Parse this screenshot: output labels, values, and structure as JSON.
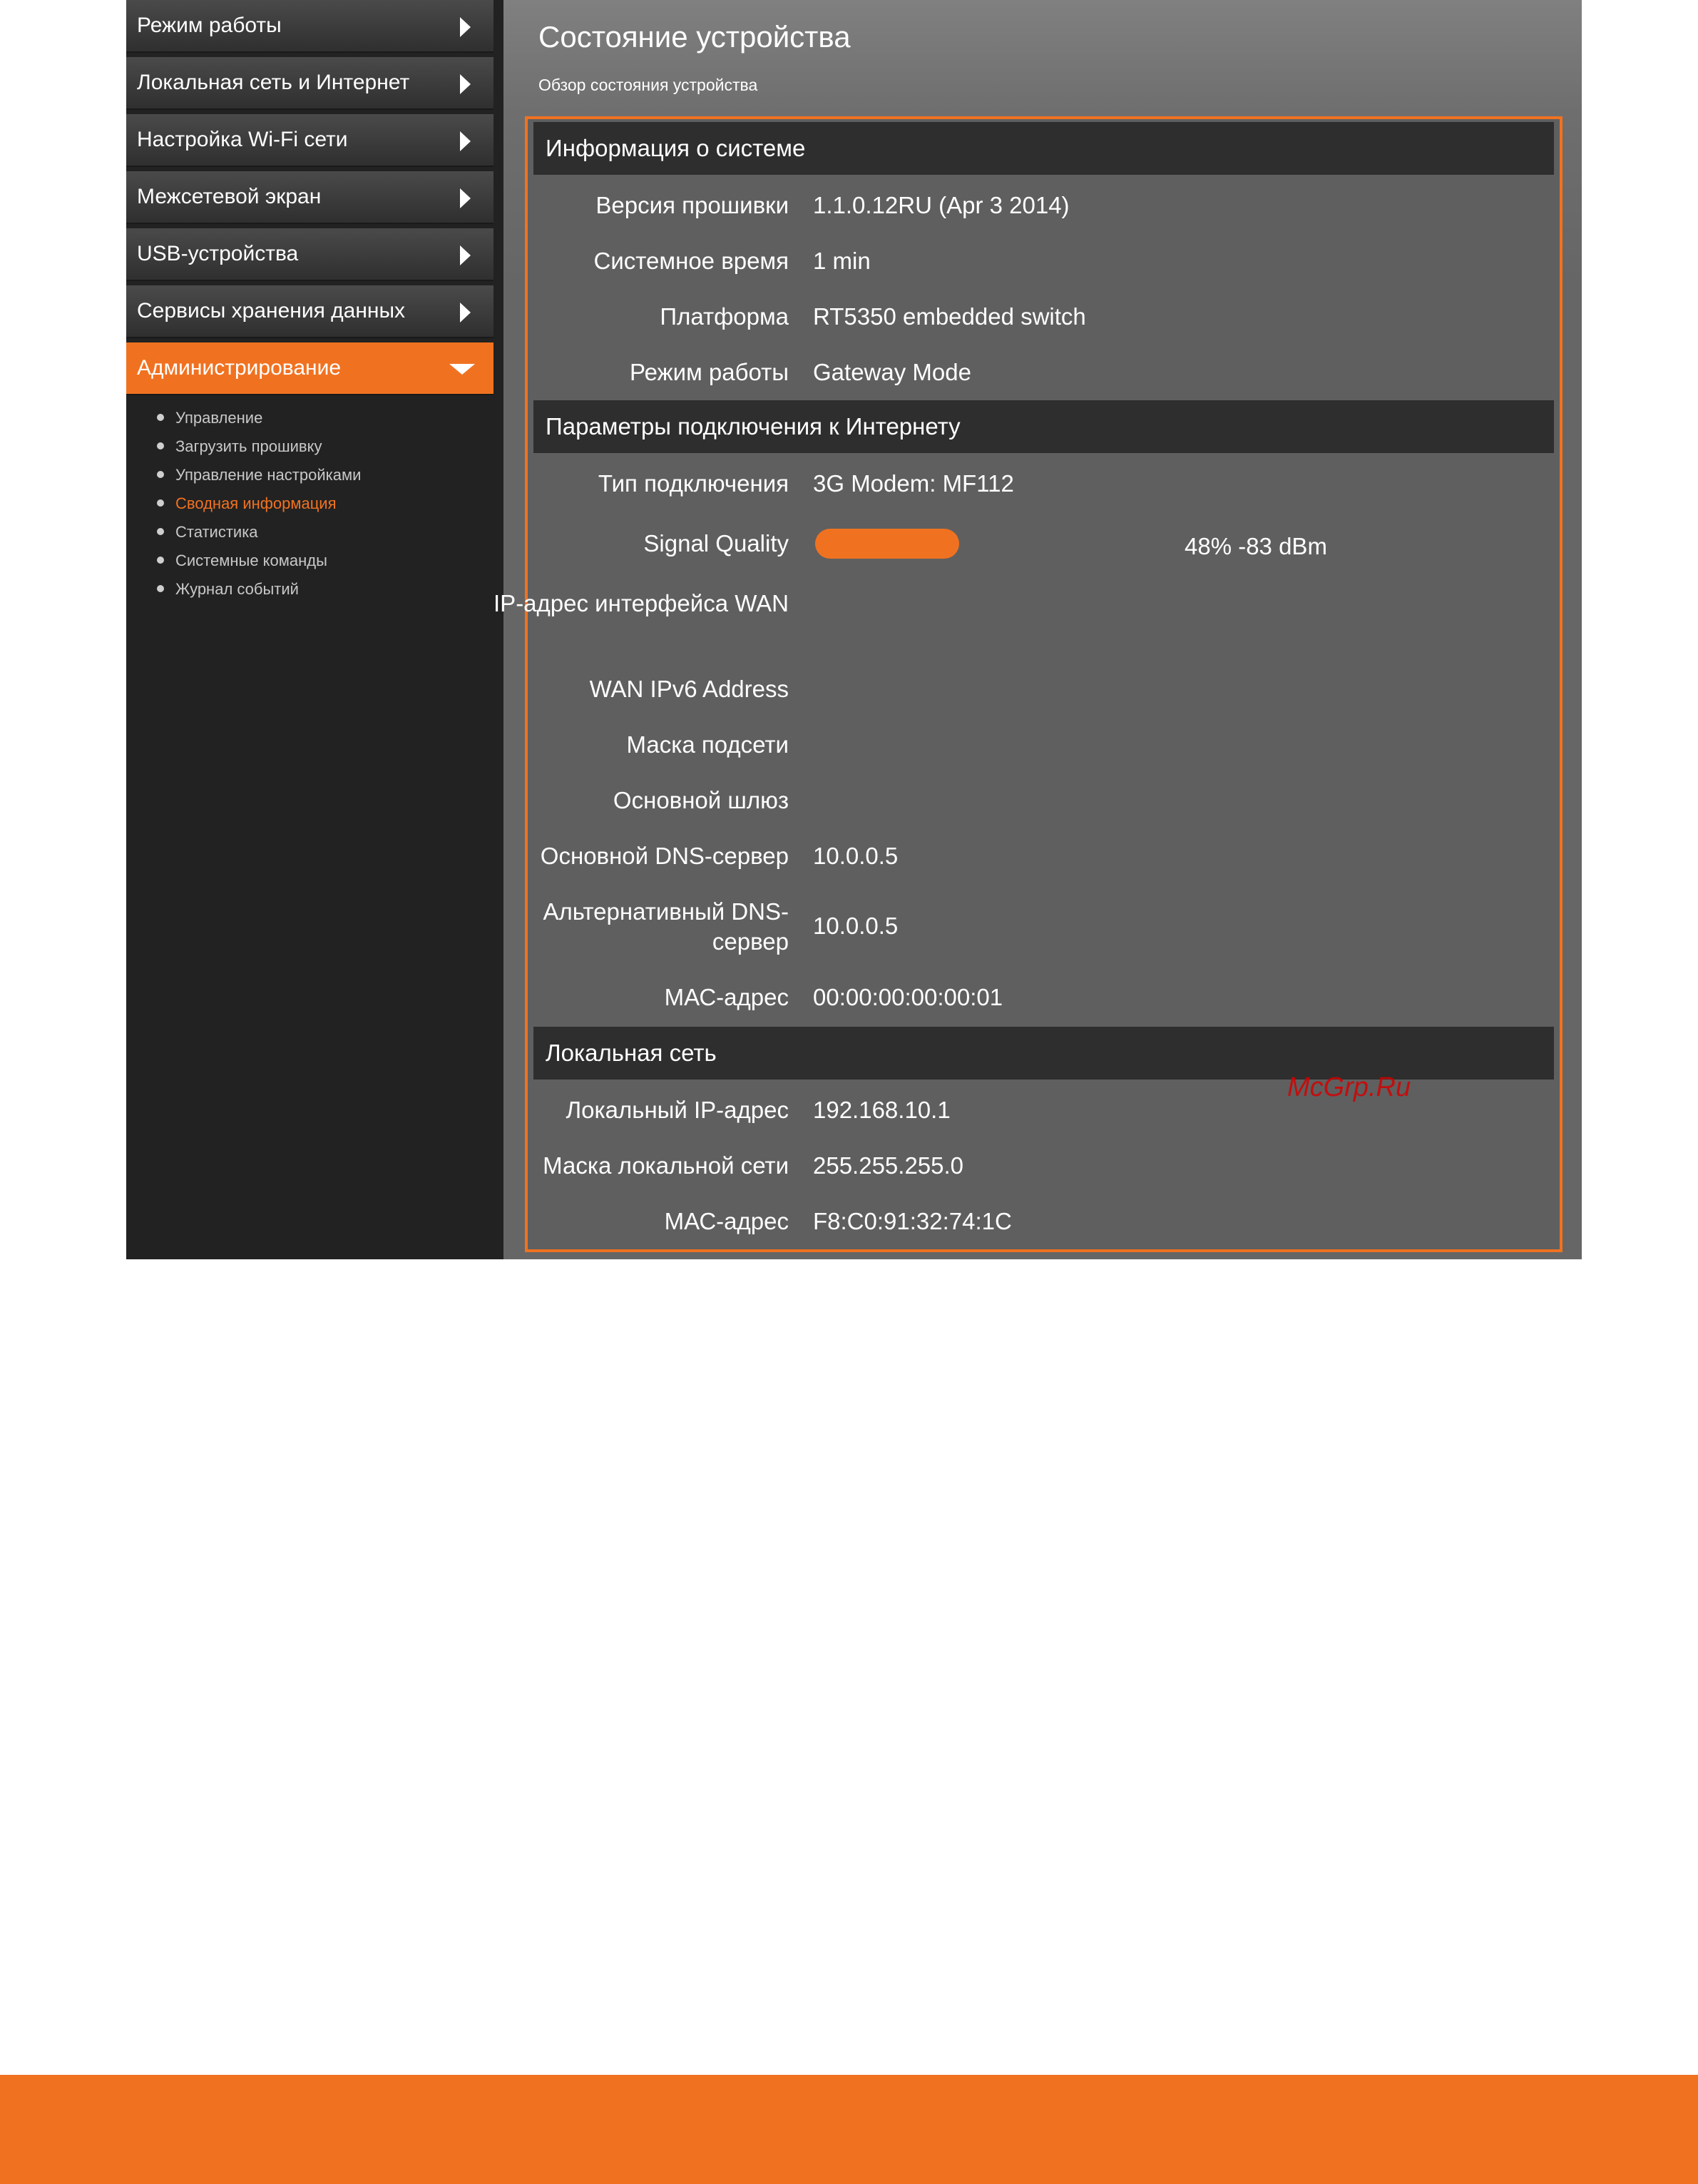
{
  "sidebar": {
    "items": [
      {
        "label": "Режим работы"
      },
      {
        "label": "Локальная сеть и Интернет"
      },
      {
        "label": "Настройка Wi-Fi сети"
      },
      {
        "label": "Межсетевой экран"
      },
      {
        "label": "USB-устройства"
      },
      {
        "label": "Сервисы хранения данных"
      },
      {
        "label": "Администрирование",
        "active": true
      }
    ],
    "submenu": [
      {
        "label": "Управление"
      },
      {
        "label": "Загрузить прошивку"
      },
      {
        "label": "Управление настройками"
      },
      {
        "label": "Сводная информация",
        "active": true
      },
      {
        "label": "Статистика"
      },
      {
        "label": "Системные команды"
      },
      {
        "label": "Журнал событий"
      }
    ]
  },
  "main": {
    "title": "Состояние устройства",
    "subtitle": "Обзор состояния устройства",
    "sections": [
      {
        "header": "Информация о системе",
        "rows": [
          {
            "label": "Версия прошивки",
            "value": "1.1.0.12RU (Apr 3 2014)"
          },
          {
            "label": "Системное время",
            "value": "1 min"
          },
          {
            "label": "Платформа",
            "value": "RT5350 embedded switch"
          },
          {
            "label": "Режим работы",
            "value": "Gateway Mode"
          }
        ]
      },
      {
        "header": "Параметры подключения к Интернету",
        "rows": [
          {
            "label": "Тип подключения",
            "value": "3G Modem: MF112"
          },
          {
            "label": "Signal Quality",
            "value": "48% -83 dBm",
            "signal_percent": 48
          },
          {
            "label": "IP-адрес интерфейса WAN",
            "value": ""
          },
          {
            "label": "WAN IPv6 Address",
            "value": ""
          },
          {
            "label": "Маска подсети",
            "value": ""
          },
          {
            "label": "Основной шлюз",
            "value": ""
          },
          {
            "label": "Основной DNS-сервер",
            "value": "10.0.0.5"
          },
          {
            "label": "Альтернативный DNS-сервер",
            "value": "10.0.0.5"
          },
          {
            "label": "МАС-адрес",
            "value": "00:00:00:00:00:01"
          }
        ]
      },
      {
        "header": "Локальная сеть",
        "rows": [
          {
            "label": "Локальный IP-адрес",
            "value": "192.168.10.1"
          },
          {
            "label": "Маска локальной сети",
            "value": "255.255.255.0"
          },
          {
            "label": "МАС-адрес",
            "value": "F8:C0:91:32:74:1C"
          }
        ]
      }
    ]
  },
  "watermark": "McGrp.Ru",
  "colors": {
    "accent": "#f07221",
    "sidebar_bg": "#222222",
    "panel_bg": "#5f5f5f",
    "section_header_bg": "#2e2e2e"
  }
}
